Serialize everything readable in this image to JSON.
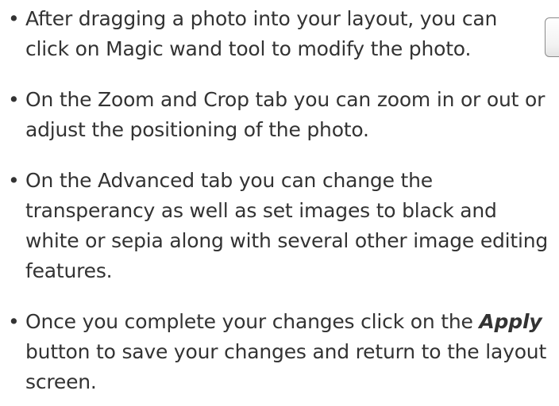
{
  "instructions": {
    "items": [
      {
        "bullet": "•",
        "text": "After dragging a photo into your layout, you can click on Magic wand tool to modify the photo."
      },
      {
        "bullet": "•",
        "text": "On the Zoom and Crop tab you can zoom in or out or adjust the positioning of  the photo."
      },
      {
        "bullet": "•",
        "text": "On the Advanced tab you can change the transperancy as well as set images to black and white or sepia along with several other image editing features."
      },
      {
        "bullet": "•",
        "text_before": "Once you complete your changes click on the ",
        "emphasis": "Apply",
        "text_after": " button to save your changes and return to the layout screen."
      }
    ]
  },
  "colors": {
    "text": "#333333",
    "background": "#ffffff",
    "button_border": "#8a8a8a"
  },
  "icons": {
    "magic_wand_button": "magic-wand-icon"
  }
}
